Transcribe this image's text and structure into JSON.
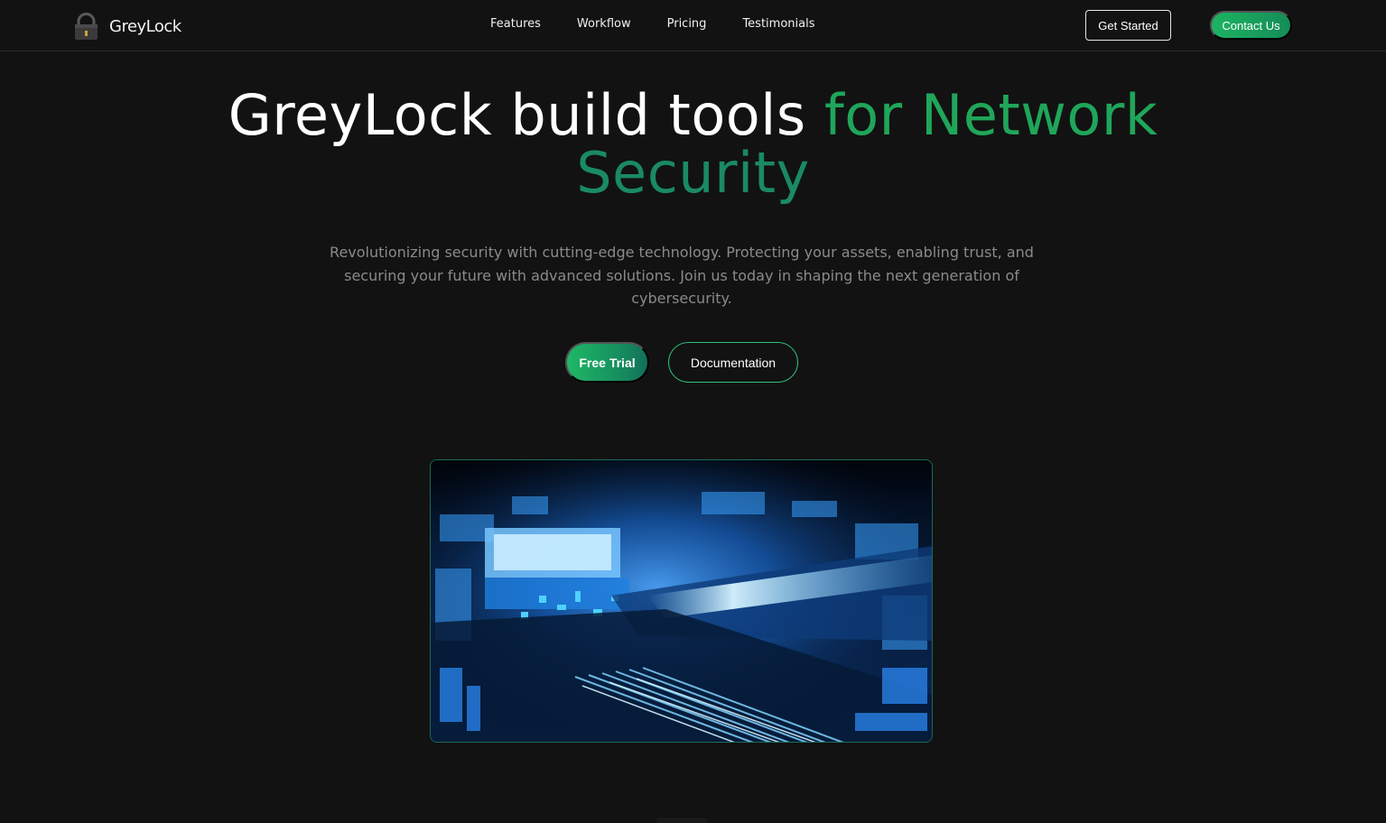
{
  "brand": {
    "name": "GreyLock",
    "logo_icon": "padlock-icon"
  },
  "nav": {
    "links": [
      "Features",
      "Workflow",
      "Pricing",
      "Testimonials"
    ],
    "get_started_label": "Get Started",
    "contact_label": "Contact Us"
  },
  "hero": {
    "title_white": "GreyLock build tools ",
    "title_green": "for Network",
    "title_green2": "Security",
    "subtitle": "Revolutionizing security with cutting-edge technology. Protecting your assets, enabling trust, and securing your future with advanced solutions. Join us today in shaping the next generation of cybersecurity.",
    "free_trial_label": "Free Trial",
    "documentation_label": "Documentation"
  },
  "colors": {
    "background": "#121212",
    "accent_green": "#1fa65a",
    "accent_teal": "#1a8a62",
    "subtitle_gray": "#8a8a8a"
  }
}
